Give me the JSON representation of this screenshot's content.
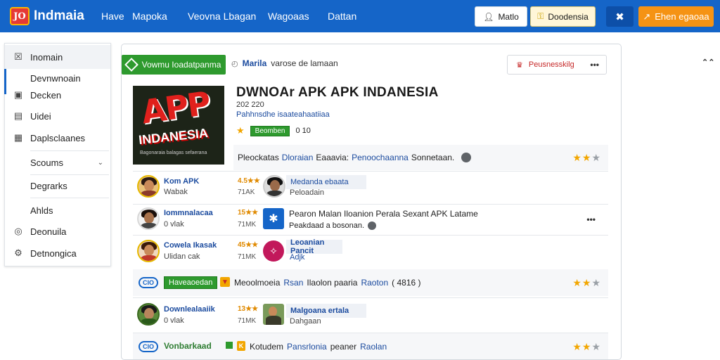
{
  "header": {
    "logo_icon": "JO",
    "logo_text": "Indmaia",
    "nav": [
      "Have",
      "Mapoka",
      "Veovna Lbagan",
      "Wagoaas",
      "Dattan"
    ],
    "btn_login": "Matlo",
    "btn_download": "Doodensia",
    "btn_apk": "Ehen egaoaa",
    "icons": [
      "user-icon",
      "key-icon",
      "tools-icon",
      "bolt-icon"
    ]
  },
  "sidebar": {
    "items": [
      {
        "label": "Inomain",
        "icon": "checkbox-icon"
      },
      {
        "label": "Devnwnoain",
        "icon": ""
      },
      {
        "label": "Decken",
        "icon": "image-icon"
      },
      {
        "label": "Uidei",
        "icon": "list-icon"
      },
      {
        "label": "Daplsclaanes",
        "icon": "grid-icon"
      },
      {
        "label": "Scoums",
        "icon": ""
      },
      {
        "label": "Degrarks",
        "icon": ""
      },
      {
        "label": "Ahlds",
        "icon": ""
      },
      {
        "label": "Deonuila",
        "icon": "circle-icon"
      },
      {
        "label": "Detnongica",
        "icon": "gear-icon"
      }
    ]
  },
  "main": {
    "download_btn": "Vowmu Ioadatpanma",
    "topline_bold": "Marila",
    "topline_rest": "varose de lamaan",
    "report_btn": "Peusnesskilg",
    "app": {
      "title": "DWNOAr APK APK INDANESIA",
      "version": "202 220",
      "subtitle": "Pahhnsdhe isaateahaatiiaa",
      "rating_badge": "Beomben",
      "size": "0 10",
      "img_line1": "APP",
      "img_line2": "INDANESIA",
      "img_line3": "Bagonaraia balagas sefaerana"
    },
    "desc": {
      "t1": "Pleockatas",
      "b1": "Dloraian",
      "t2": "Eaaavia:",
      "b2": "Penoochaanna",
      "t3": "Sonnetaan."
    },
    "rows": [
      {
        "name": "Kom APK",
        "sub": "Wabak",
        "rate": "4.5★★",
        "rsub": "71AK",
        "name2": "Medanda ebaata",
        "sub2": "Peloadain"
      },
      {
        "name": "Iommnalacaa",
        "sub": "0 vlak",
        "rate": "15★★",
        "rsub": "71MK",
        "t1": "Pearon Malan Iloanion Perala Sexant APK Latame",
        "t2": "Peakdaad a bosonan."
      },
      {
        "name": "Cowela Ikasak",
        "sub": "Ulidan cak",
        "rate": "45★★",
        "rsub": "71MK",
        "name2": "Leoanian Pancit",
        "sub2": "Adjk"
      },
      {
        "name": "Downlealaaiik",
        "sub": "0 vlak",
        "rate": "13★★",
        "rsub": "71MK",
        "name2": "Malgoana ertala",
        "sub2": "Dahgaan"
      }
    ],
    "strip1": {
      "pill": "CIO",
      "tag": "Haveaoedan",
      "t1": "Meoolmoeia",
      "b1": "Rsan",
      "t2": "Ilaolon paaria",
      "b2": "Raoton",
      "t3": "( 4816 )"
    },
    "strip2": {
      "pill": "CIO",
      "tag": "Vonbarkaad",
      "t1": "Kotudem",
      "b1": "Pansrlonia",
      "t2": "peaner",
      "b2": "Raolan"
    }
  }
}
